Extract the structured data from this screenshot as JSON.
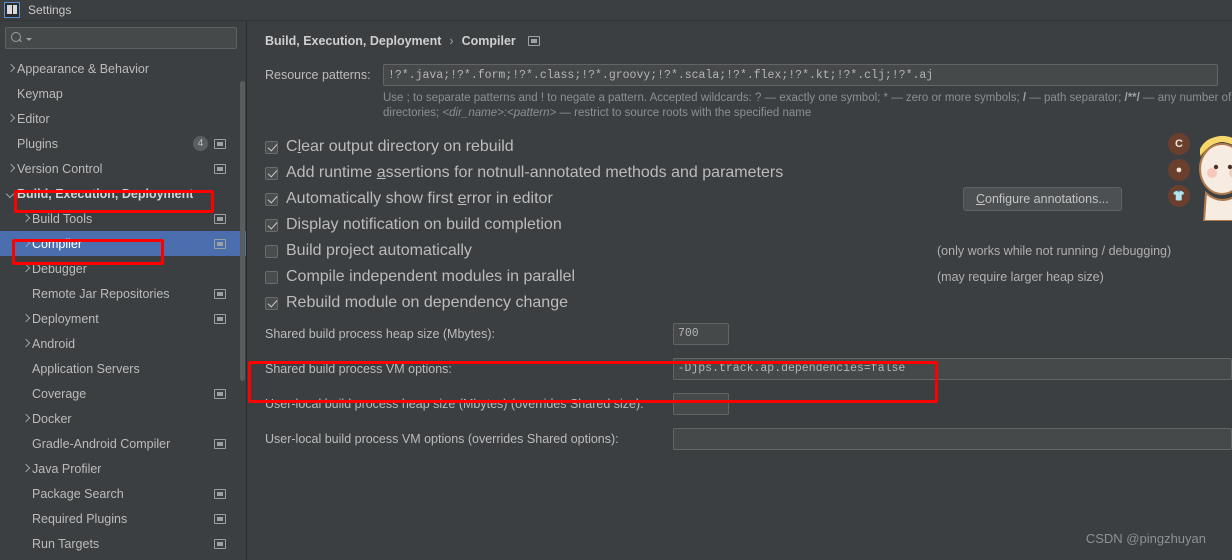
{
  "window": {
    "title": "Settings",
    "icon": "intellij-idea-icon"
  },
  "sidebar": {
    "search": {
      "value": "",
      "placeholder": "",
      "icon": "search-icon"
    },
    "items": [
      {
        "label": "Appearance & Behavior",
        "arrow": "right",
        "indent": 0,
        "badge": "",
        "scope_icon": false,
        "selected": false,
        "bold": false
      },
      {
        "label": "Keymap",
        "arrow": "none",
        "indent": 0,
        "badge": "",
        "scope_icon": false,
        "selected": false,
        "bold": false
      },
      {
        "label": "Editor",
        "arrow": "right",
        "indent": 0,
        "badge": "",
        "scope_icon": false,
        "selected": false,
        "bold": false
      },
      {
        "label": "Plugins",
        "arrow": "none",
        "indent": 0,
        "badge": "4",
        "scope_icon": true,
        "selected": false,
        "bold": false
      },
      {
        "label": "Version Control",
        "arrow": "right",
        "indent": 0,
        "badge": "",
        "scope_icon": true,
        "selected": false,
        "bold": false
      },
      {
        "label": "Build, Execution, Deployment",
        "arrow": "down",
        "indent": 0,
        "badge": "",
        "scope_icon": false,
        "selected": false,
        "bold": true
      },
      {
        "label": "Build Tools",
        "arrow": "right",
        "indent": 1,
        "badge": "",
        "scope_icon": true,
        "selected": false,
        "bold": false
      },
      {
        "label": "Compiler",
        "arrow": "right",
        "indent": 1,
        "badge": "",
        "scope_icon": true,
        "selected": true,
        "bold": false
      },
      {
        "label": "Debugger",
        "arrow": "right",
        "indent": 1,
        "badge": "",
        "scope_icon": false,
        "selected": false,
        "bold": false
      },
      {
        "label": "Remote Jar Repositories",
        "arrow": "none",
        "indent": 1,
        "badge": "",
        "scope_icon": true,
        "selected": false,
        "bold": false
      },
      {
        "label": "Deployment",
        "arrow": "right",
        "indent": 1,
        "badge": "",
        "scope_icon": true,
        "selected": false,
        "bold": false
      },
      {
        "label": "Android",
        "arrow": "right",
        "indent": 1,
        "badge": "",
        "scope_icon": false,
        "selected": false,
        "bold": false
      },
      {
        "label": "Application Servers",
        "arrow": "none",
        "indent": 1,
        "badge": "",
        "scope_icon": false,
        "selected": false,
        "bold": false
      },
      {
        "label": "Coverage",
        "arrow": "none",
        "indent": 1,
        "badge": "",
        "scope_icon": true,
        "selected": false,
        "bold": false
      },
      {
        "label": "Docker",
        "arrow": "right",
        "indent": 1,
        "badge": "",
        "scope_icon": false,
        "selected": false,
        "bold": false
      },
      {
        "label": "Gradle-Android Compiler",
        "arrow": "none",
        "indent": 1,
        "badge": "",
        "scope_icon": true,
        "selected": false,
        "bold": false
      },
      {
        "label": "Java Profiler",
        "arrow": "right",
        "indent": 1,
        "badge": "",
        "scope_icon": false,
        "selected": false,
        "bold": false
      },
      {
        "label": "Package Search",
        "arrow": "none",
        "indent": 1,
        "badge": "",
        "scope_icon": true,
        "selected": false,
        "bold": false
      },
      {
        "label": "Required Plugins",
        "arrow": "none",
        "indent": 1,
        "badge": "",
        "scope_icon": true,
        "selected": false,
        "bold": false
      },
      {
        "label": "Run Targets",
        "arrow": "none",
        "indent": 1,
        "badge": "",
        "scope_icon": true,
        "selected": false,
        "bold": false
      }
    ]
  },
  "main": {
    "breadcrumb": {
      "root": "Build, Execution, Deployment",
      "separator": "›",
      "leaf": "Compiler",
      "icon": "project-scope-icon"
    },
    "resource_patterns": {
      "label": "Resource patterns:",
      "value": "!?*.java;!?*.form;!?*.class;!?*.groovy;!?*.scala;!?*.flex;!?*.kt;!?*.clj;!?*.aj",
      "hint_line1_a": "Use ; to separate patterns and ! to negate a pattern. Accepted wildcards: ? — exactly one symbol; * — zero or more symbols; ",
      "hint_line1_b": "/",
      "hint_line1_c": " — path separator; ",
      "hint_line1_d": "/**/",
      "hint_line1_e": " — any number of",
      "hint_line2_a": "directories; ",
      "hint_line2_b": "<dir_name>:<pattern>",
      "hint_line2_c": " — restrict to source roots with the specified name"
    },
    "checkboxes": [
      {
        "label_pre": "C",
        "mnemonic": "l",
        "label_post": "ear output directory on rebuild",
        "checked": true,
        "note": ""
      },
      {
        "label_pre": "Add runtime ",
        "mnemonic": "a",
        "label_post": "ssertions for notnull-annotated methods and parameters",
        "checked": true,
        "note": ""
      },
      {
        "label_pre": "Automatically show first ",
        "mnemonic": "e",
        "label_post": "rror in editor",
        "checked": true,
        "note": ""
      },
      {
        "label_pre": "Display notification on build completion",
        "mnemonic": "",
        "label_post": "",
        "checked": true,
        "note": ""
      },
      {
        "label_pre": "Build project automatically",
        "mnemonic": "",
        "label_post": "",
        "checked": false,
        "note": "(only works while not running / debugging)"
      },
      {
        "label_pre": "Compile independent modules in parallel",
        "mnemonic": "",
        "label_post": "",
        "checked": false,
        "note": "(may require larger heap size)"
      },
      {
        "label_pre": "Rebuild module on dependency change",
        "mnemonic": "",
        "label_post": "",
        "checked": true,
        "note": ""
      }
    ],
    "configure_annotations_button": {
      "label_pre": "C",
      "mnemonic": "C",
      "label": "Configure annotations..."
    },
    "fields": [
      {
        "label": "Shared build process heap size (Mbytes):",
        "value": "700",
        "wide": false
      },
      {
        "label": "Shared build process VM options:",
        "value": "-Djps.track.ap.dependencies=false",
        "wide": true
      },
      {
        "label": "User-local build process heap size (Mbytes) (overrides Shared size):",
        "value": "",
        "wide": false
      },
      {
        "label": "User-local build process VM options (overrides Shared options):",
        "value": "",
        "wide": true
      }
    ]
  },
  "annotations": {
    "highlight_color": "#ff0000",
    "boxes": [
      "build-execution-deployment-tree-item",
      "compiler-tree-item",
      "shared-build-process-vm-options-row"
    ]
  },
  "overlay": {
    "mascot_buttons": [
      "C",
      "●",
      "👕"
    ],
    "watermark": "CSDN @pingzhuyan"
  }
}
